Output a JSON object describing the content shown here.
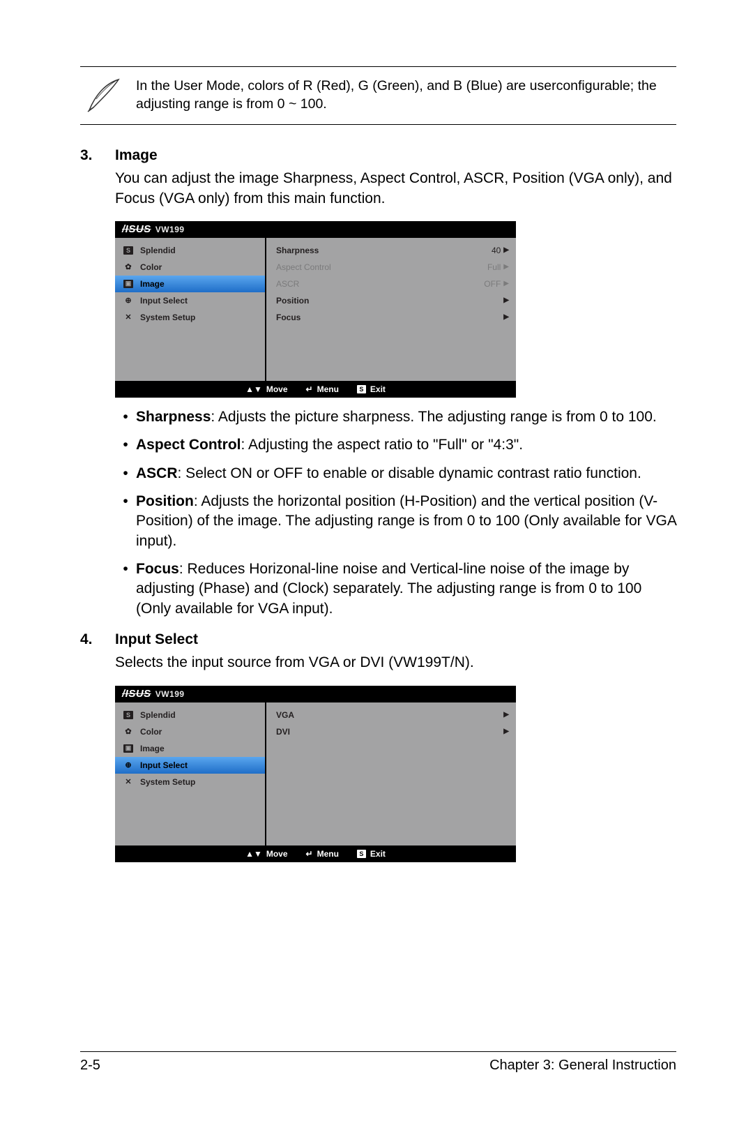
{
  "note": {
    "text": "In the User Mode, colors of R (Red), G (Green), and B (Blue) are userconfigurable; the adjusting range is from 0 ~ 100."
  },
  "sections": {
    "s3": {
      "num": "3.",
      "title": "Image",
      "desc": "You can adjust the image Sharpness, Aspect Control, ASCR, Position (VGA only), and Focus (VGA only) from this main function.",
      "bullets": [
        {
          "label": "Sharpness",
          "text": ": Adjusts the picture sharpness. The adjusting range is from 0 to 100."
        },
        {
          "label": "Aspect Control",
          "text": ": Adjusting the aspect ratio to \"Full\" or \"4:3\"."
        },
        {
          "label": "ASCR",
          "text": ": Select ON or OFF to enable or disable dynamic contrast ratio function."
        },
        {
          "label": "Position",
          "text": ": Adjusts the horizontal position (H-Position) and the vertical position (V-Position) of the image. The adjusting range is from 0 to 100 (Only available for VGA input)."
        },
        {
          "label": "Focus",
          "text": ": Reduces Horizonal-line noise and Vertical-line noise of the image by adjusting (Phase) and (Clock) separately. The adjusting range is from 0 to 100 (Only available for VGA input)."
        }
      ]
    },
    "s4": {
      "num": "4.",
      "title": "Input Select",
      "desc": "Selects the input source from VGA or DVI (VW199T/N)."
    }
  },
  "osd": {
    "brand": "/ISUS",
    "model": "VW199",
    "menu": {
      "splendid": "Splendid",
      "color": "Color",
      "image": "Image",
      "input": "Input Select",
      "system": "System Setup"
    },
    "footer": {
      "move": "Move",
      "menu": "Menu",
      "exit": "Exit"
    }
  },
  "osd1": {
    "selected": "image",
    "options": [
      {
        "label": "Sharpness",
        "value": "40",
        "disabled": false
      },
      {
        "label": "Aspect Control",
        "value": "Full",
        "disabled": true
      },
      {
        "label": "ASCR",
        "value": "OFF",
        "disabled": true
      },
      {
        "label": "Position",
        "value": "",
        "disabled": false
      },
      {
        "label": "Focus",
        "value": "",
        "disabled": false
      }
    ]
  },
  "osd2": {
    "selected": "input",
    "options": [
      {
        "label": "VGA",
        "value": "",
        "disabled": false
      },
      {
        "label": "DVI",
        "value": "",
        "disabled": false
      }
    ]
  },
  "footer": {
    "left": "2-5",
    "right": "Chapter 3: General Instruction"
  }
}
